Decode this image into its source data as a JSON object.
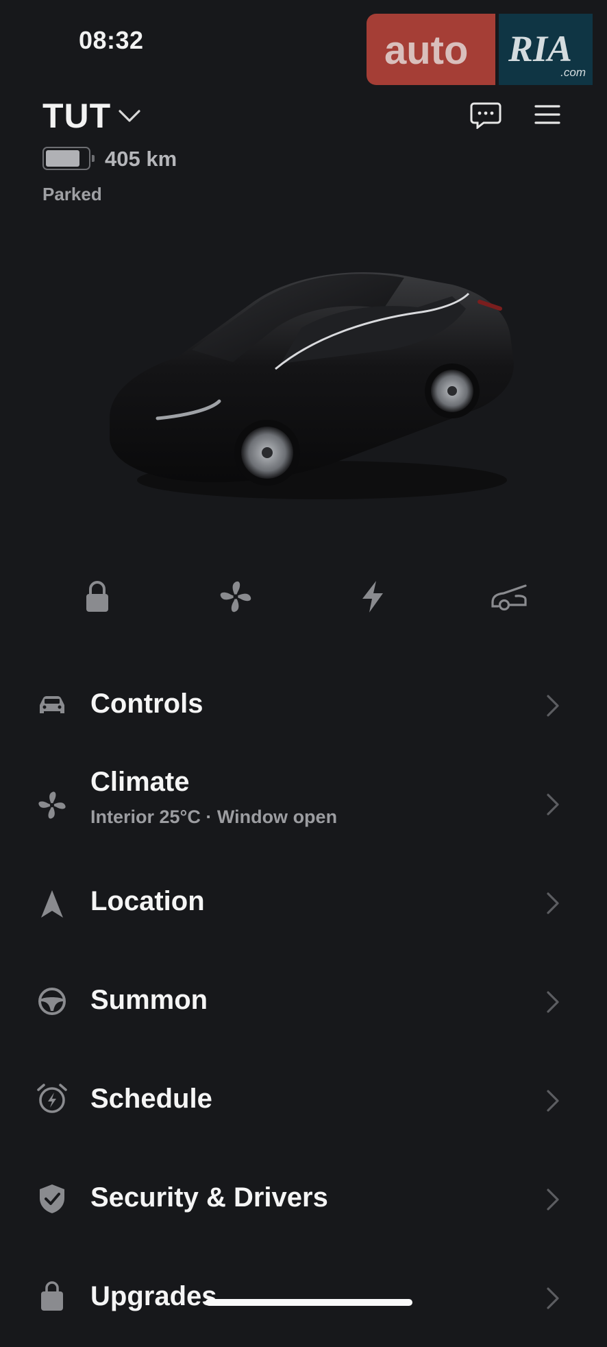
{
  "status_bar": {
    "time": "08:32"
  },
  "watermark": {
    "brand_left": "auto",
    "brand_right": "RIA",
    "brand_suffix": ".com"
  },
  "header": {
    "vehicle_name": "TUT",
    "range": "405 km",
    "battery_level": 0.85,
    "state": "Parked",
    "icons": {
      "dropdown": "chevron-down-icon",
      "messages": "chat-bubble-icon",
      "menu": "hamburger-menu-icon"
    }
  },
  "quick_actions": [
    {
      "name": "lock",
      "icon": "lock-icon"
    },
    {
      "name": "climate",
      "icon": "fan-icon"
    },
    {
      "name": "charge",
      "icon": "bolt-icon"
    },
    {
      "name": "frunk",
      "icon": "frunk-icon"
    }
  ],
  "menu": {
    "items": [
      {
        "label": "Controls",
        "sublabel": "",
        "icon": "car-icon"
      },
      {
        "label": "Climate",
        "sublabel": "Interior 25°C · Window open",
        "icon": "fan-icon"
      },
      {
        "label": "Location",
        "sublabel": "",
        "icon": "navigation-arrow-icon"
      },
      {
        "label": "Summon",
        "sublabel": "",
        "icon": "steering-wheel-icon"
      },
      {
        "label": "Schedule",
        "sublabel": "",
        "icon": "alarm-clock-icon"
      },
      {
        "label": "Security & Drivers",
        "sublabel": "",
        "icon": "shield-check-icon"
      },
      {
        "label": "Upgrades",
        "sublabel": "",
        "icon": "shopping-bag-icon"
      }
    ]
  },
  "colors": {
    "background": "#17181b",
    "text": "#f2f2f2",
    "muted": "#9c9da1",
    "icon": "#8a8b8f"
  }
}
